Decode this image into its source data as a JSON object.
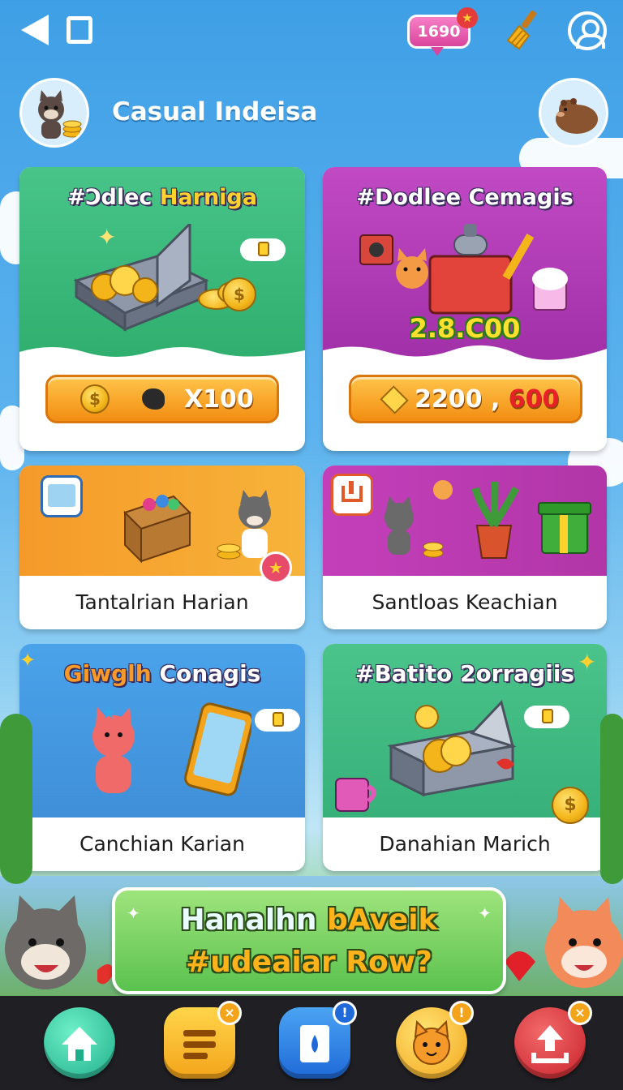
{
  "status": {
    "coins": "1690"
  },
  "header": {
    "title": "Casual Indeisa"
  },
  "cards": [
    {
      "title_part1": "#Ͻdlec ",
      "title_part2": "Harniga",
      "button": {
        "label": "X100"
      }
    },
    {
      "title": "#Dodlee Cemagis",
      "amount": "2.8.C00",
      "button": {
        "label": "2200 , ",
        "highlight": "600"
      }
    },
    {
      "label": "Tantalrian Harian"
    },
    {
      "label": "Santloas Keachian"
    },
    {
      "title_part1": "Giwglh ",
      "title_part2": "Conagis",
      "label": "Canchian Karian"
    },
    {
      "title": "#Batito 2orragiis",
      "label": "Danahian Marich"
    }
  ],
  "banner": {
    "line1_part1": "Hanalhn ",
    "line1_part2": "bAveik",
    "line2": "#udeaiar Row?"
  },
  "colors": {
    "orange": "#f28d12",
    "green": "#45b86e",
    "magenta": "#b63fb2",
    "blue": "#3f93de",
    "navbar": "#1f1f24"
  },
  "nav": [
    "home-icon",
    "list-icon",
    "note-icon",
    "cat-face-icon",
    "upload-icon"
  ]
}
